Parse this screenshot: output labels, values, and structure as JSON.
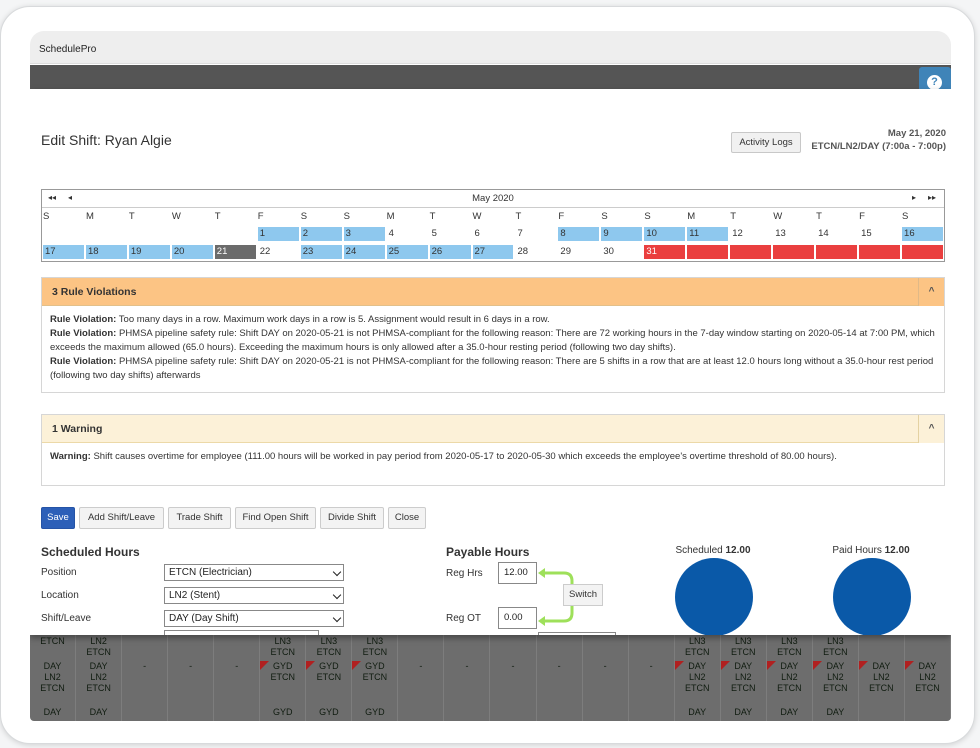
{
  "app": {
    "title": "SchedulePro",
    "help_icon": "?"
  },
  "header": {
    "title": "Edit Shift: Ryan Algie",
    "activity_logs": "Activity Logs",
    "date": "May 21, 2020",
    "shift_info": "ETCN/LN2/DAY (7:00a - 7:00p)"
  },
  "calendar": {
    "month": "May 2020",
    "nav_first": "◂◂",
    "nav_prev": "◂",
    "nav_next": "▸",
    "nav_last": "▸▸",
    "days_of_week": [
      "S",
      "M",
      "T",
      "W",
      "T",
      "F",
      "S",
      "S",
      "M",
      "T",
      "W",
      "T",
      "F",
      "S",
      "S",
      "M",
      "T",
      "W",
      "T",
      "F",
      "S"
    ],
    "row1": [
      "",
      "",
      "",
      "",
      "",
      "1",
      "2",
      "3",
      "4",
      "5",
      "6",
      "7",
      "8",
      "9",
      "10",
      "11",
      "12",
      "13",
      "14",
      "15",
      "16"
    ],
    "row1_state": [
      "",
      "",
      "",
      "",
      "",
      "shift",
      "shift",
      "shift",
      "",
      "",
      "",
      "",
      "shift",
      "shift",
      "shift",
      "shift",
      "",
      "",
      "",
      "",
      "shift"
    ],
    "row2": [
      "17",
      "18",
      "19",
      "20",
      "21",
      "22",
      "23",
      "24",
      "25",
      "26",
      "27",
      "28",
      "29",
      "30",
      "31",
      "",
      "",
      "",
      "",
      "",
      ""
    ],
    "row2_state": [
      "shift",
      "shift",
      "shift",
      "shift",
      "current",
      "",
      "shift",
      "shift",
      "shift",
      "shift",
      "shift",
      "",
      "",
      "",
      "out",
      "out",
      "out",
      "out",
      "out",
      "out",
      "out"
    ],
    "colors": {
      "shift": "#8ec8ee",
      "current": "#6b6b6b",
      "out": "#ea3f3f"
    }
  },
  "violations": {
    "title": "3 Rule Violations",
    "collapse_icon": "^",
    "items": [
      {
        "label": "Rule Violation:",
        "text": " Too many days in a row. Maximum work days in a row is 5. Assignment would result in 6 days in a row."
      },
      {
        "label": "Rule Violation:",
        "text": " PHMSA pipeline safety rule: Shift DAY on 2020-05-21 is not PHMSA-compliant for the following reason: There are 72 working hours in the 7-day window starting on 2020-05-14 at 7:00 PM, which exceeds the maximum allowed (65.0 hours). Exceeding the maximum hours is only allowed after a 35.0-hour resting period (following two day shifts)."
      },
      {
        "label": "Rule Violation:",
        "text": " PHMSA pipeline safety rule: Shift DAY on 2020-05-21 is not PHMSA-compliant for the following reason: There are 5 shifts in a row that are at least 12.0 hours long without a 35.0-hour rest period (following two day shifts) afterwards"
      }
    ]
  },
  "warnings": {
    "title": "1 Warning",
    "collapse_icon": "^",
    "label": "Warning:",
    "text": " Shift causes overtime for employee (111.00 hours will be worked in pay period from 2020-05-17 to 2020-05-30 which exceeds the employee's overtime threshold of 80.00 hours)."
  },
  "actions": {
    "save": "Save",
    "add_shift": "Add Shift/Leave",
    "trade_shift": "Trade Shift",
    "find_open": "Find Open Shift",
    "divide": "Divide Shift",
    "close": "Close"
  },
  "scheduled": {
    "title": "Scheduled Hours",
    "position_label": "Position",
    "position_value": "ETCN (Electrician)",
    "location_label": "Location",
    "location_value": "LN2 (Stent)",
    "shift_label": "Shift/Leave",
    "shift_value": "DAY (Day Shift)"
  },
  "payable": {
    "title": "Payable Hours",
    "reg_hrs_label": "Reg Hrs",
    "reg_hrs_value": "12.00",
    "reg_ot_label": "Reg OT",
    "reg_ot_value": "0.00",
    "switch": "Switch"
  },
  "summary": {
    "scheduled_label": "Scheduled",
    "scheduled_value": "12.00",
    "paid_label": "Paid Hours",
    "paid_value": "12.00",
    "circle_color": "#0a59a8"
  },
  "background_grid": {
    "columns": [
      [
        "ETCN",
        "DAY\nLN2\nETCN",
        "DAY"
      ],
      [
        "LN2\nETCN",
        "DAY\nLN2\nETCN",
        "DAY"
      ],
      [
        "",
        "-",
        ""
      ],
      [
        "",
        "-",
        ""
      ],
      [
        "",
        "-",
        ""
      ],
      [
        "LN3\nETCN",
        "GYD\nETCN",
        "GYD"
      ],
      [
        "LN3\nETCN",
        "GYD\nETCN",
        "GYD"
      ],
      [
        "LN3\nETCN",
        "GYD\nETCN",
        "GYD"
      ],
      [
        "",
        "-",
        ""
      ],
      [
        "",
        "-",
        ""
      ],
      [
        "",
        "-",
        ""
      ],
      [
        "",
        "-",
        ""
      ],
      [
        "",
        "-",
        ""
      ],
      [
        "",
        "-",
        ""
      ],
      [
        "LN3\nETCN",
        "DAY\nLN2\nETCN",
        "DAY"
      ],
      [
        "LN3\nETCN",
        "DAY\nLN2\nETCN",
        "DAY"
      ],
      [
        "LN3\nETCN",
        "DAY\nLN2\nETCN",
        "DAY"
      ],
      [
        "LN3\nETCN",
        "DAY\nLN2\nETCN",
        "DAY"
      ],
      [
        "",
        "DAY\nLN2\nETCN",
        ""
      ],
      [
        "",
        "DAY\nLN2\nETCN",
        ""
      ]
    ]
  }
}
